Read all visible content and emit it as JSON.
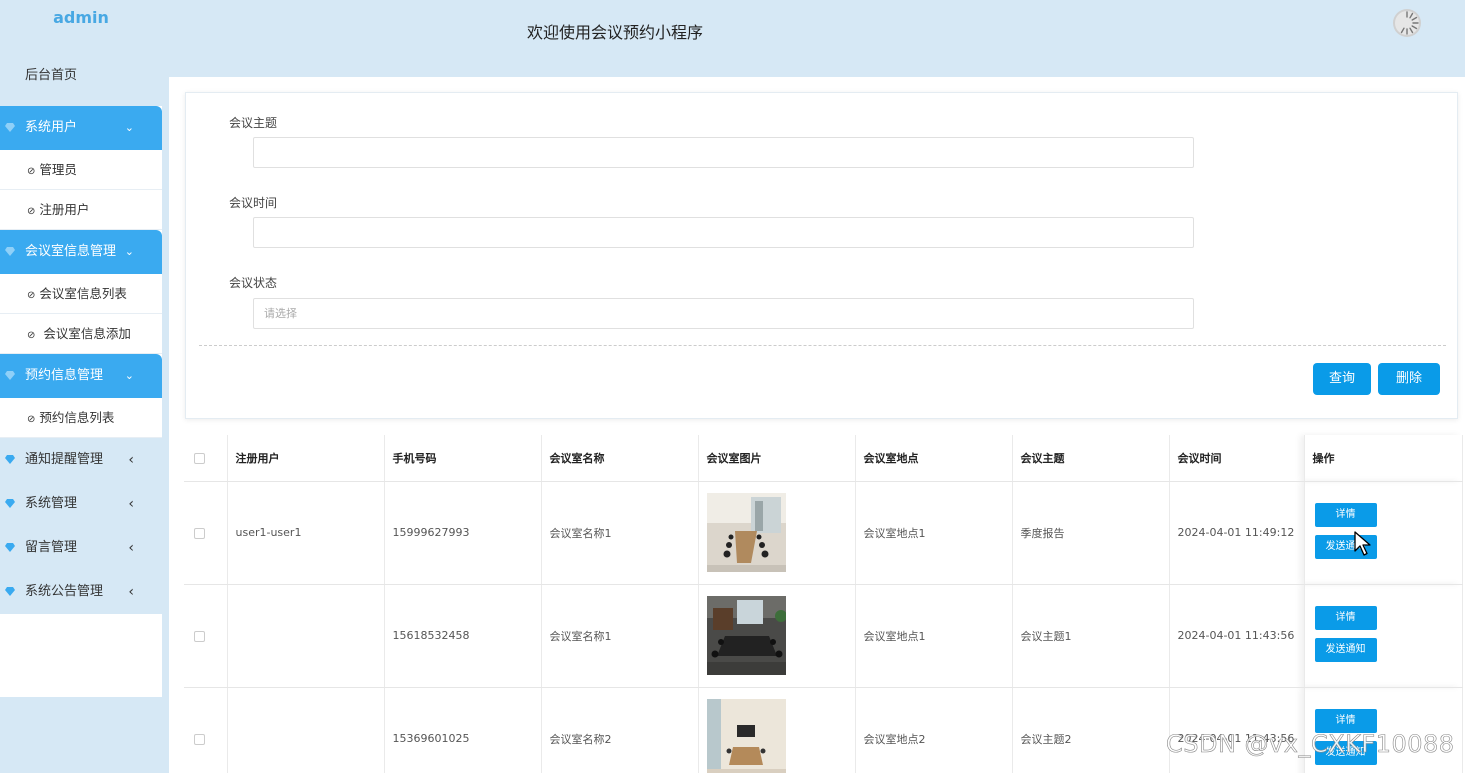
{
  "sidebar": {
    "brand": "admin",
    "home": "后台首页",
    "groups": [
      {
        "label": "系统用户",
        "arrow": "⌄",
        "items": [
          "管理员",
          "注册用户"
        ]
      },
      {
        "label": "会议室信息管理",
        "arrow": "⌄",
        "items": [
          "会议室信息列表",
          "会议室信息添加"
        ]
      },
      {
        "label": "预约信息管理",
        "arrow": "⌄",
        "items": [
          "预约信息列表"
        ]
      },
      {
        "label": "通知提醒管理",
        "arrow": "‹",
        "items": []
      },
      {
        "label": "系统管理",
        "arrow": "‹",
        "items": []
      },
      {
        "label": "留言管理",
        "arrow": "‹",
        "items": []
      },
      {
        "label": "系统公告管理",
        "arrow": "‹",
        "items": []
      }
    ],
    "item_icon": "⊘"
  },
  "header": {
    "title": "欢迎使用会议预约小程序"
  },
  "search": {
    "topic_label": "会议主题",
    "topic_value": "",
    "time_label": "会议时间",
    "time_value": "",
    "status_label": "会议状态",
    "status_placeholder": "请选择",
    "query_button": "查询",
    "delete_button": "删除"
  },
  "table": {
    "columns": [
      "注册用户",
      "手机号码",
      "会议室名称",
      "会议室图片",
      "会议室地点",
      "会议主题",
      "会议时间",
      "操作"
    ],
    "rows": [
      {
        "user": "user1-user1",
        "phone": "15999627993",
        "room": "会议室名称1",
        "place": "会议室地点1",
        "topic": "季度报告",
        "time": "2024-04-01 11:49:12",
        "detail": "详情",
        "notify": "发送通知"
      },
      {
        "user": "",
        "phone": "15618532458",
        "room": "会议室名称1",
        "place": "会议室地点1",
        "topic": "会议主题1",
        "time": "2024-04-01 11:43:56",
        "detail": "详情",
        "notify": "发送通知"
      },
      {
        "user": "",
        "phone": "15369601025",
        "room": "会议室名称2",
        "place": "会议室地点2",
        "topic": "会议主题2",
        "time": "2024-04-01 11:43:56",
        "detail": "详情",
        "notify": "发送通知"
      }
    ]
  },
  "watermark": "CSDN @vx_CXKF10088",
  "colors": {
    "accent": "#0a9be8",
    "sidebar_active": "#3aaaf0",
    "background": "#d6e8f5"
  }
}
